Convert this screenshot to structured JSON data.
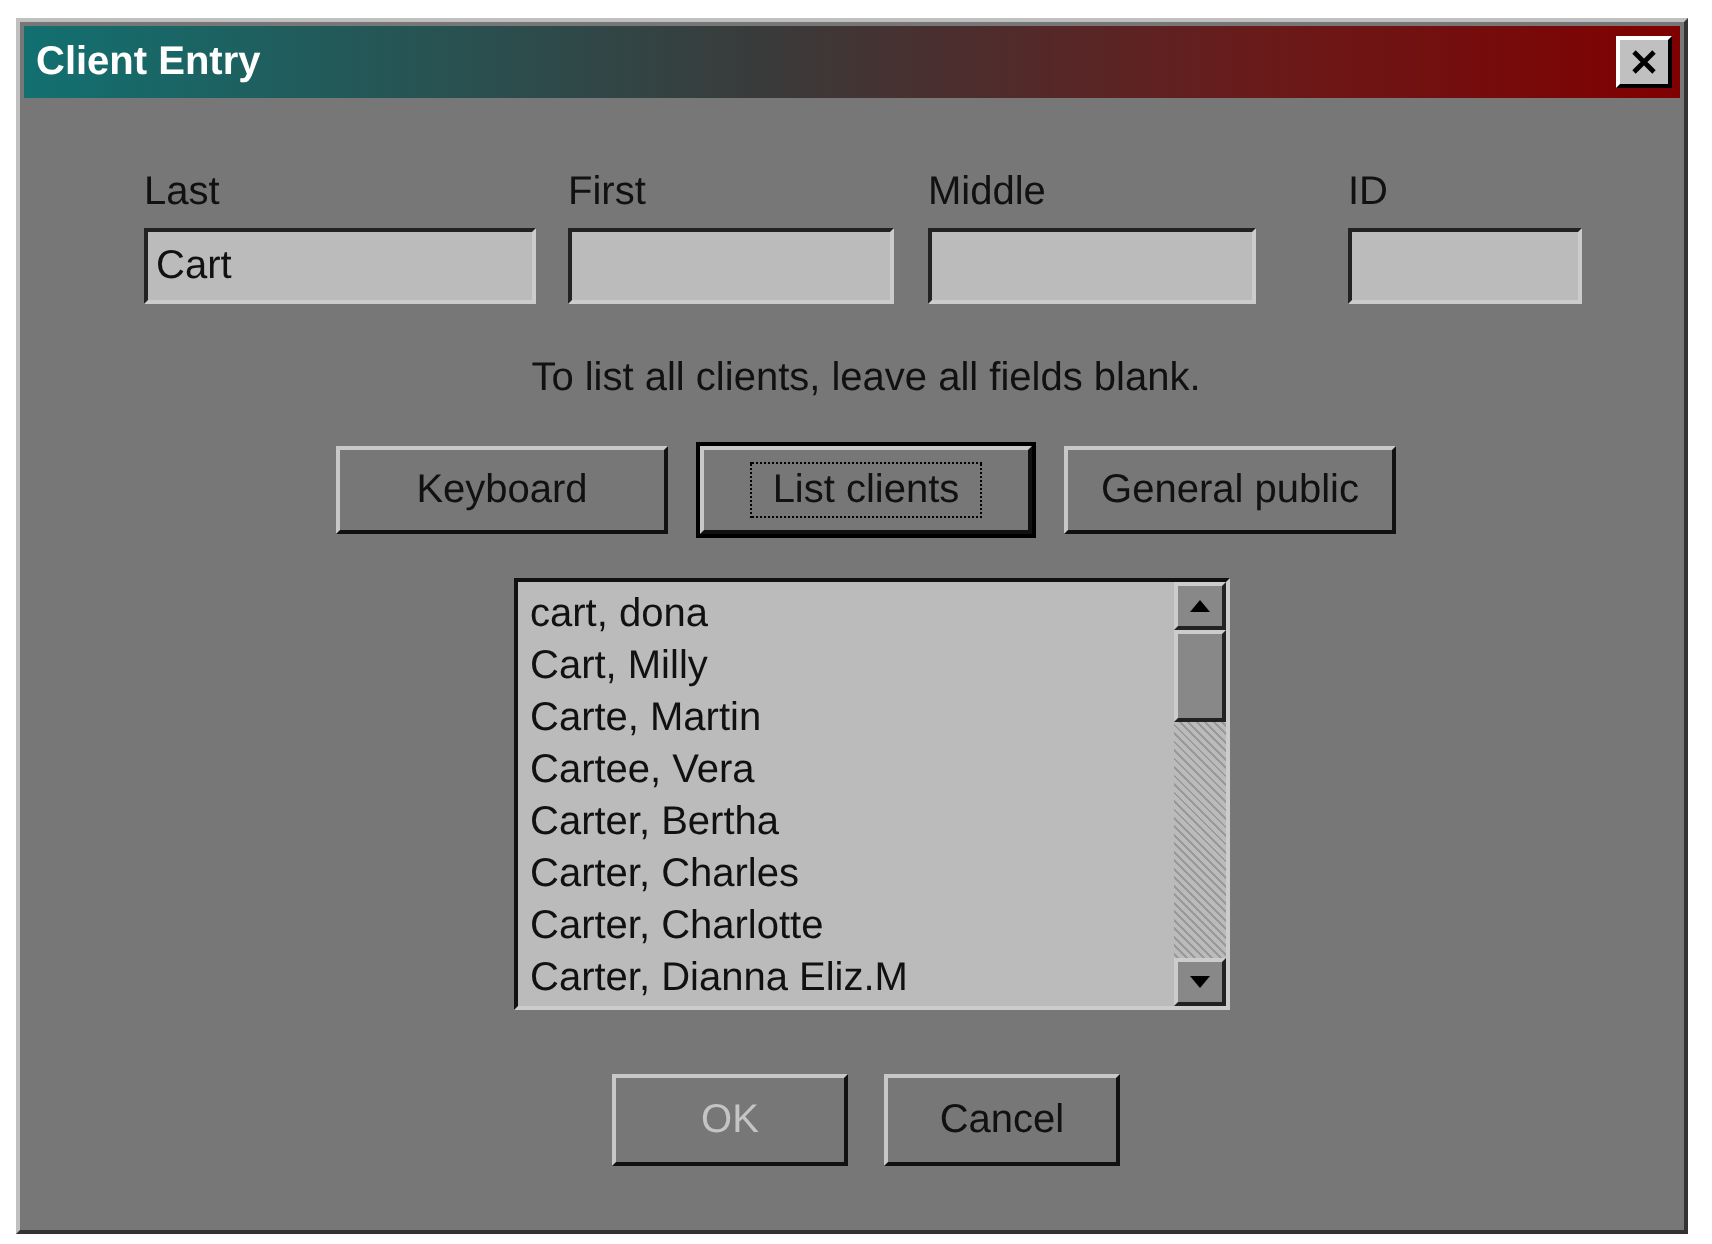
{
  "window": {
    "title": "Client Entry"
  },
  "fields": [
    {
      "label": "Last",
      "value": "Cart"
    },
    {
      "label": "First"
    },
    {
      "label": "Middle"
    },
    {
      "label": "ID"
    }
  ],
  "hint": "To list all clients, leave all fields blank.",
  "actions": [
    {
      "label": "Keyboard",
      "focused": false
    },
    {
      "label": "List clients",
      "focused": true
    },
    {
      "label": "General public",
      "focused": false
    }
  ],
  "list": {
    "items": [
      "cart, dona",
      "Cart, Milly",
      "Carte, Martin",
      "Cartee, Vera",
      "Carter, Bertha",
      "Carter, Charles",
      "Carter, Charlotte",
      "Carter, Dianna Eliz.M"
    ]
  },
  "buttons": [
    {
      "label": "OK",
      "disabled": true
    },
    {
      "label": "Cancel",
      "disabled": false
    }
  ]
}
